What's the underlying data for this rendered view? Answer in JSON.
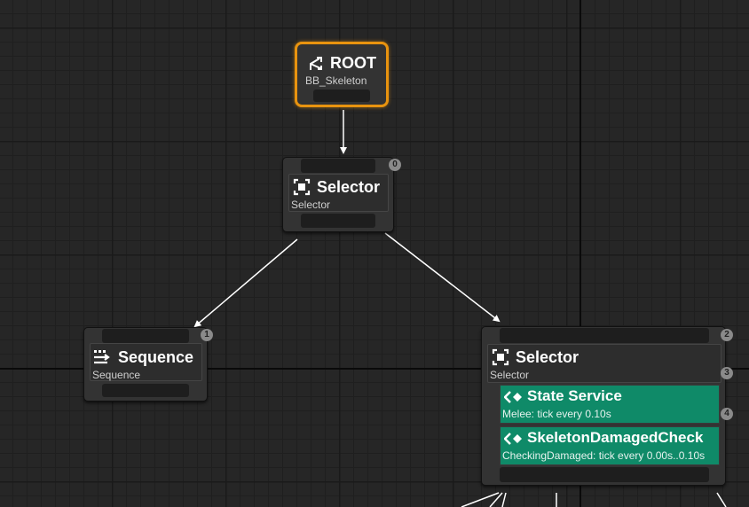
{
  "root": {
    "title": "ROOT",
    "subtitle": "BB_Skeleton"
  },
  "selector_top": {
    "title": "Selector",
    "subtitle": "Selector",
    "index": "0"
  },
  "sequence": {
    "title": "Sequence",
    "subtitle": "Sequence",
    "index": "1"
  },
  "selector_right": {
    "title": "Selector",
    "subtitle": "Selector",
    "index": "2",
    "services": [
      {
        "title": "State Service",
        "detail": "Melee: tick every 0.10s",
        "index": "3"
      },
      {
        "title": "SkeletonDamagedCheck",
        "detail": "CheckingDamaged: tick every 0.00s..0.10s",
        "index": "4"
      }
    ]
  },
  "colors": {
    "root_border": "#e8930f",
    "service": "#0f8a68",
    "node": "#333333",
    "grid": "#262626"
  },
  "icons": {
    "root": "root-branch-icon",
    "selector": "selector-icon",
    "sequence": "sequence-icon",
    "service": "service-icon"
  }
}
